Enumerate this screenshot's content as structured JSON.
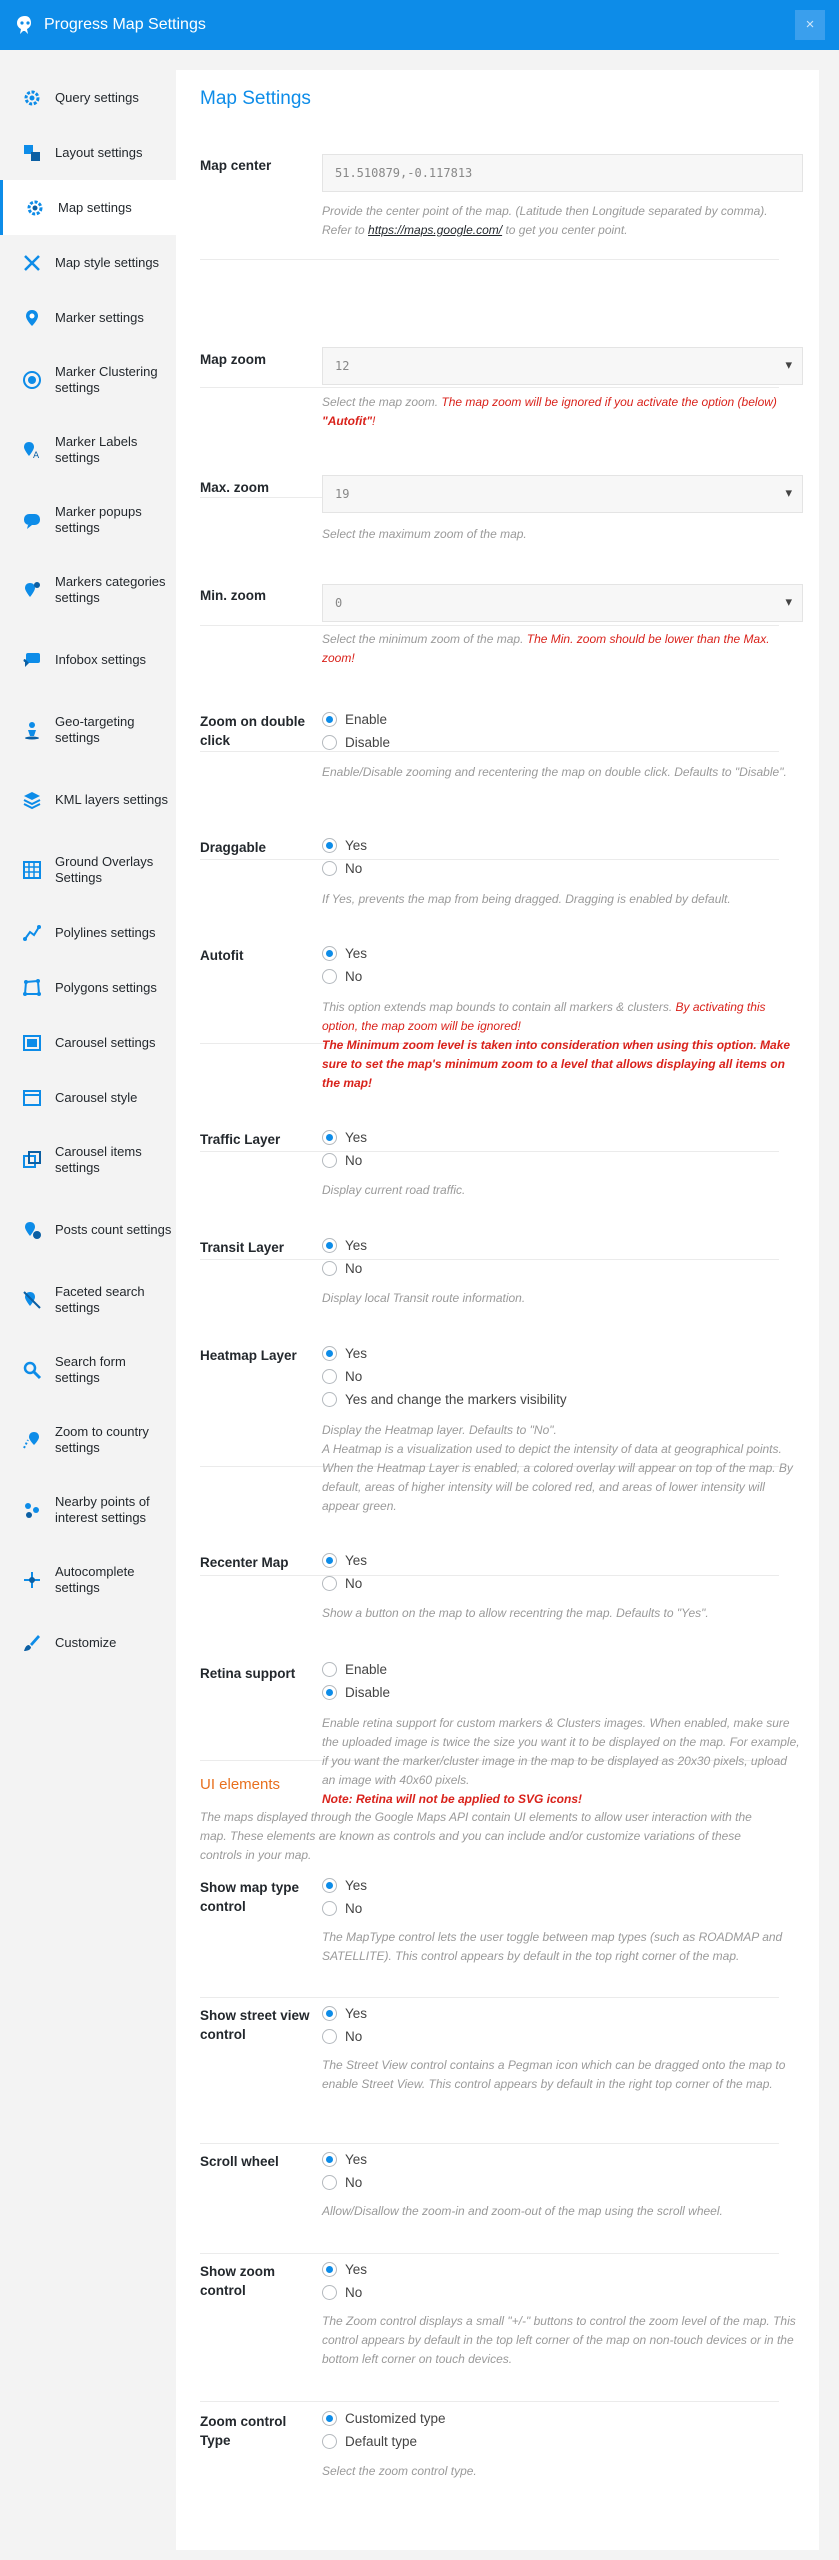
{
  "header": {
    "title": "Progress Map Settings",
    "close": "×"
  },
  "colors": {
    "accent": "#0d8ce8",
    "section": "#e8701e",
    "warning": "#d9221b"
  },
  "sidebar": {
    "items": [
      {
        "label": "Query settings",
        "icon": "gear-icon"
      },
      {
        "label": "Layout settings",
        "icon": "layout-icon"
      },
      {
        "label": "Map settings",
        "icon": "map-gear-icon"
      },
      {
        "label": "Map style settings",
        "icon": "style-icon"
      },
      {
        "label": "Marker settings",
        "icon": "marker-icon"
      },
      {
        "label": "Marker Clustering settings",
        "icon": "cluster-icon"
      },
      {
        "label": "Marker Labels settings",
        "icon": "label-icon"
      },
      {
        "label": "Marker popups settings",
        "icon": "popup-icon"
      },
      {
        "label": "Markers categories settings",
        "icon": "categories-icon"
      },
      {
        "label": "Infobox settings",
        "icon": "infobox-icon"
      },
      {
        "label": "Geo-targeting settings",
        "icon": "geo-icon"
      },
      {
        "label": "KML layers settings",
        "icon": "layers-icon"
      },
      {
        "label": "Ground Overlays Settings",
        "icon": "overlay-icon"
      },
      {
        "label": "Polylines settings",
        "icon": "polyline-icon"
      },
      {
        "label": "Polygons settings",
        "icon": "polygon-icon"
      },
      {
        "label": "Carousel settings",
        "icon": "carousel-icon"
      },
      {
        "label": "Carousel style",
        "icon": "carousel-style-icon"
      },
      {
        "label": "Carousel items settings",
        "icon": "carousel-items-icon"
      },
      {
        "label": "Posts count settings",
        "icon": "count-icon"
      },
      {
        "label": "Faceted search settings",
        "icon": "faceted-icon"
      },
      {
        "label": "Search form settings",
        "icon": "search-icon"
      },
      {
        "label": "Zoom to country settings",
        "icon": "country-icon"
      },
      {
        "label": "Nearby points of interest settings",
        "icon": "nearby-icon"
      },
      {
        "label": "Autocomplete settings",
        "icon": "autocomplete-icon"
      },
      {
        "label": "Customize",
        "icon": "brush-icon"
      }
    ]
  },
  "main": {
    "title": "Map Settings",
    "map_center": {
      "label": "Map center",
      "value": "51.510879,-0.117813",
      "desc1": "Provide the center point of the map. (Latitude then Longitude separated by comma).",
      "desc2a": "Refer to ",
      "link": "https://maps.google.com/",
      "desc2b": " to get you center point."
    },
    "map_zoom": {
      "label": "Map zoom",
      "value": "12",
      "desc": "Select the map zoom. ",
      "warn": "The map zoom will be ignored if you activate the option (below)",
      "warn_b": "\"Autofit\"",
      "warn_end": "!"
    },
    "max_zoom": {
      "label": "Max. zoom",
      "value": "19",
      "desc": "Select the maximum zoom of the map."
    },
    "min_zoom": {
      "label": "Min. zoom",
      "value": "0",
      "desc": "Select the minimum zoom of the map. ",
      "warn": "The Min. zoom should be lower than the Max. zoom!"
    },
    "zoom_dbl": {
      "label": "Zoom on double click",
      "opt1": "Enable",
      "opt2": "Disable",
      "desc": "Enable/Disable zooming and recentering the map on double click. Defaults to \"Disable\"."
    },
    "draggable": {
      "label": "Draggable",
      "opt1": "Yes",
      "opt2": "No",
      "desc": "If Yes, prevents the map from being dragged. Dragging is enabled by default."
    },
    "autofit": {
      "label": "Autofit",
      "opt1": "Yes",
      "opt2": "No",
      "desc": "This option extends map bounds to contain all markers & clusters. ",
      "warn": "By activating this option, the map zoom will be ignored!",
      "bwarn": "The Minimum zoom level is taken into consideration when using this option. Make sure to set the map's minimum zoom to a level that allows displaying all items on the map!"
    },
    "traffic": {
      "label": "Traffic Layer",
      "opt1": "Yes",
      "opt2": "No",
      "desc": "Display current road traffic."
    },
    "transit": {
      "label": "Transit Layer",
      "opt1": "Yes",
      "opt2": "No",
      "desc": "Display local Transit route information."
    },
    "heatmap": {
      "label": "Heatmap Layer",
      "opt1": "Yes",
      "opt2": "No",
      "opt3": "Yes and change the markers visibility",
      "desc": "Display the Heatmap layer. Defaults to \"No\".",
      "desc2": "A Heatmap is a visualization used to depict the intensity of data at geographical points. When the Heatmap Layer is enabled, a colored overlay will appear on top of the map. By default, areas of higher intensity will be colored red, and areas of lower intensity will appear green."
    },
    "recenter": {
      "label": "Recenter Map",
      "opt1": "Yes",
      "opt2": "No",
      "desc": "Show a button on the map to allow recentring the map. Defaults to \"Yes\"."
    },
    "retina": {
      "label": "Retina support",
      "opt1": "Enable",
      "opt2": "Disable",
      "desc": "Enable retina support for custom markers & Clusters images. When enabled, make sure the uploaded image is twice the size you want it to be displayed on the map. For example, if you want the marker/cluster image in the map to be displayed as 20x30 pixels, upload an image with 40x60 pixels.",
      "bwarn": "Note: Retina will not be applied to SVG icons!"
    },
    "ui_title": "UI elements",
    "ui_desc": "The maps displayed through the Google Maps API contain UI elements to allow user interaction with the map. These elements are known as controls and you can include and/or customize variations of these controls in your map.",
    "maptype": {
      "label": "Show map type control",
      "opt1": "Yes",
      "opt2": "No",
      "desc": "The MapType control lets the user toggle between map types (such as ROADMAP and SATELLITE). This control appears by default in the top right corner of the map."
    },
    "streetview": {
      "label": "Show street view control",
      "opt1": "Yes",
      "opt2": "No",
      "desc": "The Street View control contains a Pegman icon which can be dragged onto the map to enable Street View. This control appears by default in the right top corner of the map."
    },
    "scroll": {
      "label": "Scroll wheel",
      "opt1": "Yes",
      "opt2": "No",
      "desc": "Allow/Disallow the zoom-in and zoom-out of the map using the scroll wheel."
    },
    "zoomctl": {
      "label": "Show zoom control",
      "opt1": "Yes",
      "opt2": "No",
      "desc": "The Zoom control displays a small \"+/-\" buttons to control the zoom level of the map. This control appears by default in the top left corner of the map on non-touch devices or in the bottom left corner on touch devices."
    },
    "zoomtype": {
      "label": "Zoom control Type",
      "opt1": "Customized type",
      "opt2": "Default type",
      "desc": "Select the zoom control type."
    }
  }
}
